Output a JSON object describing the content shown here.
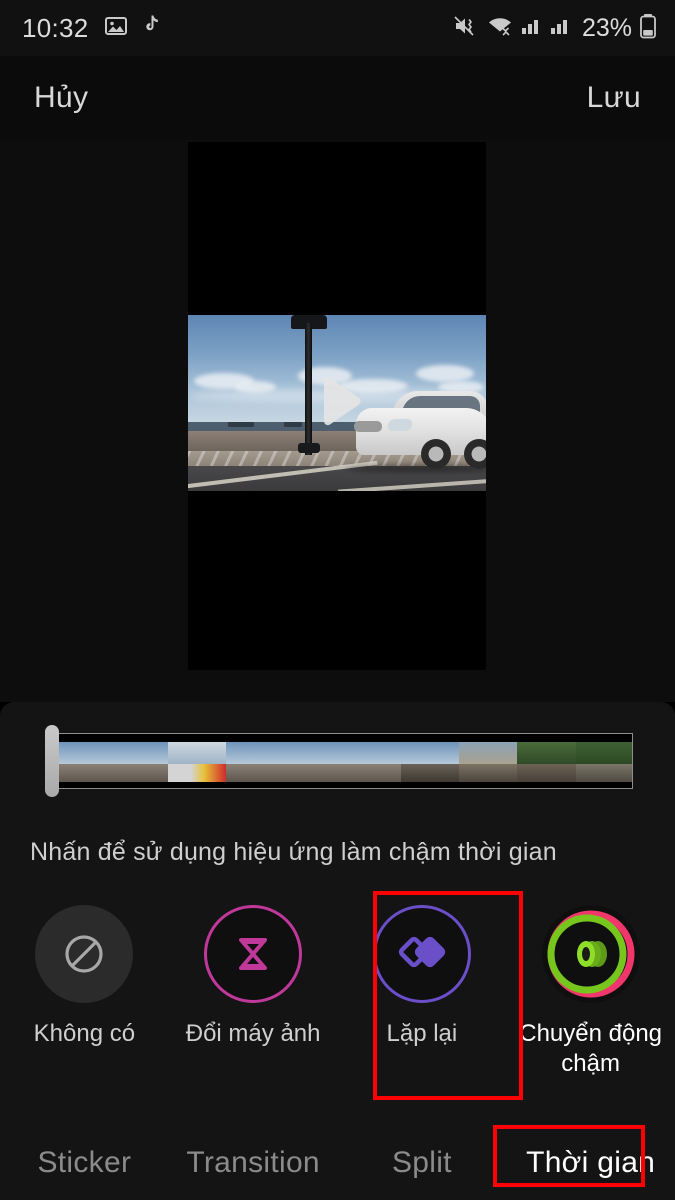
{
  "status_bar": {
    "time": "10:32",
    "battery_percent": "23%",
    "left_icons": [
      "photo-gallery-icon",
      "tiktok-icon"
    ],
    "right_icons": [
      "mute-vibrate-icon",
      "wifi-icon",
      "signal-sim1-icon",
      "signal-sim2-icon",
      "battery-icon"
    ]
  },
  "top_bar": {
    "cancel_label": "Hủy",
    "save_label": "Lưu"
  },
  "preview": {
    "play_icon": "play-icon"
  },
  "timeline": {
    "handle": "trim-handle"
  },
  "hint": {
    "text": "Nhấn để sử dụng hiệu ứng làm chậm thời gian"
  },
  "options": [
    {
      "label": "Không có",
      "icon": "no-effect-icon",
      "color": "#9a9a9a",
      "selected": false
    },
    {
      "label": "Đổi máy ảnh",
      "icon": "hourglass-icon",
      "color": "#c0399a",
      "selected": false
    },
    {
      "label": "Lặp lại",
      "icon": "loop-diamonds-icon",
      "color": "#6b4fc9",
      "selected": false
    },
    {
      "label": "Chuyển động chậm",
      "icon": "slow-motion-icon",
      "color": "#76c61e",
      "selected": true
    }
  ],
  "tabs": [
    {
      "label": "Sticker",
      "active": false
    },
    {
      "label": "Transition",
      "active": false
    },
    {
      "label": "Split",
      "active": false
    },
    {
      "label": "Thời gian",
      "active": true
    }
  ],
  "annotation_color": "#ff0000"
}
